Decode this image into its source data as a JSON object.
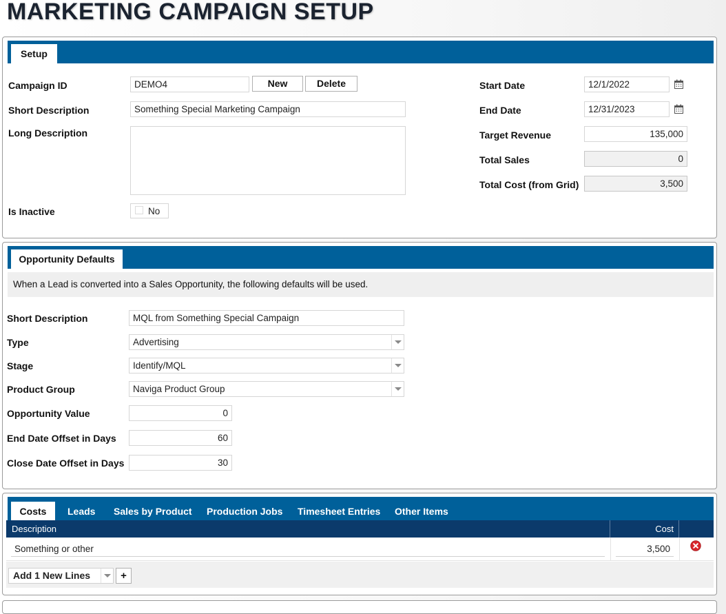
{
  "page": {
    "title": "MARKETING CAMPAIGN SETUP"
  },
  "setup": {
    "tab_label": "Setup",
    "campaign_id_label": "Campaign ID",
    "campaign_id_value": "DEMO4",
    "new_button": "New",
    "delete_button": "Delete",
    "short_description_label": "Short Description",
    "short_description_value": "Something Special Marketing Campaign",
    "long_description_label": "Long Description",
    "long_description_value": "",
    "is_inactive_label": "Is Inactive",
    "is_inactive_value": "No",
    "start_date_label": "Start Date",
    "start_date_value": "12/1/2022",
    "end_date_label": "End Date",
    "end_date_value": "12/31/2023",
    "target_revenue_label": "Target Revenue",
    "target_revenue_value": "135,000",
    "total_sales_label": "Total Sales",
    "total_sales_value": "0",
    "total_cost_label": "Total Cost (from Grid)",
    "total_cost_value": "3,500",
    "calendar_icon": "calendar-icon"
  },
  "opportunity": {
    "tab_label": "Opportunity Defaults",
    "info_text": "When a Lead is converted into a Sales Opportunity, the following defaults will be used.",
    "short_description_label": "Short Description",
    "short_description_value": "MQL from Something Special Campaign",
    "type_label": "Type",
    "type_value": "Advertising",
    "stage_label": "Stage",
    "stage_value": "Identify/MQL",
    "product_group_label": "Product Group",
    "product_group_value": "Naviga Product Group",
    "opportunity_value_label": "Opportunity Value",
    "opportunity_value_value": "0",
    "end_date_offset_label": "End Date Offset in Days",
    "end_date_offset_value": "60",
    "close_date_offset_label": "Close Date Offset in Days",
    "close_date_offset_value": "30"
  },
  "costs": {
    "tabs": [
      "Costs",
      "Leads",
      "Sales by Product",
      "Production Jobs",
      "Timesheet Entries",
      "Other Items"
    ],
    "columns": {
      "description": "Description",
      "cost": "Cost"
    },
    "rows": [
      {
        "description": "Something or other",
        "cost": "3,500"
      }
    ],
    "add_lines_label": "Add 1 New Lines",
    "add_button": "+",
    "delete_icon": "delete-row-icon"
  },
  "colors": {
    "accent": "#00609a",
    "grid_header": "#0b3a6b",
    "delete_red": "#d9262b"
  }
}
